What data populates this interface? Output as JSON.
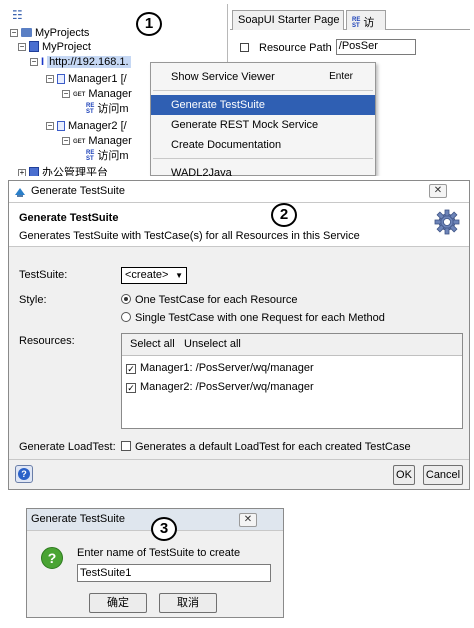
{
  "panel1": {
    "badge": "1",
    "tree": {
      "root": "MyProjects",
      "project": "MyProject",
      "service": "http://192.168.1.",
      "nodes": [
        {
          "label": "Manager1 [/",
          "kind": "resource"
        },
        {
          "label": "Manager",
          "kind": "method",
          "method": "GET"
        },
        {
          "label": "访问m",
          "kind": "request"
        },
        {
          "label": "Manager2 [/",
          "kind": "resource"
        },
        {
          "label": "Manager",
          "kind": "method",
          "method": "GET"
        },
        {
          "label": "访问m",
          "kind": "request"
        },
        {
          "label": "办公管理平台",
          "kind": "project"
        }
      ]
    },
    "tabs": [
      {
        "label": "SoapUI Starter Page"
      },
      {
        "label": "访"
      }
    ],
    "resource_path_label": "Resource Path",
    "resource_path_value": "/PosSer",
    "context_menu": [
      {
        "label": "Show Service Viewer",
        "shortcut": "Enter",
        "highlighted": false
      },
      {
        "label": "Generate TestSuite",
        "shortcut": "",
        "highlighted": true
      },
      {
        "label": "Generate REST Mock Service",
        "shortcut": "",
        "highlighted": false
      },
      {
        "label": "Create Documentation",
        "shortcut": "",
        "highlighted": false
      },
      {
        "label": "WADL2Java",
        "shortcut": "",
        "highlighted": false
      }
    ]
  },
  "panel2": {
    "badge": "2",
    "window_title": "Generate TestSuite",
    "header_title": "Generate TestSuite",
    "header_desc": "Generates TestSuite with TestCase(s) for all Resources in this Service",
    "testsuite_label": "TestSuite:",
    "testsuite_value": "<create>",
    "style_label": "Style:",
    "style_options": [
      {
        "label": "One TestCase for each Resource",
        "selected": true
      },
      {
        "label": "Single TestCase with one Request for each Method",
        "selected": false
      }
    ],
    "resources_label": "Resources:",
    "select_all": "Select all",
    "unselect_all": "Unselect all",
    "resources": [
      {
        "label": "Manager1: /PosServer/wq/manager",
        "checked": true
      },
      {
        "label": "Manager2: /PosServer/wq/manager",
        "checked": true
      }
    ],
    "loadtest_label": "Generate LoadTest:",
    "loadtest_desc": "Generates a default LoadTest for each created TestCase",
    "loadtest_checked": false,
    "ok": "OK",
    "cancel": "Cancel"
  },
  "panel3": {
    "badge": "3",
    "window_title": "Generate TestSuite",
    "prompt": "Enter name of TestSuite to create",
    "input_value": "TestSuite1",
    "ok": "确定",
    "cancel": "取消"
  },
  "colors": {
    "menu_highlight": "#2f5fb3",
    "tree_selection": "#c6d8f4",
    "question_icon": "#4aa434",
    "dialog_bg": "#f0f0f0"
  }
}
